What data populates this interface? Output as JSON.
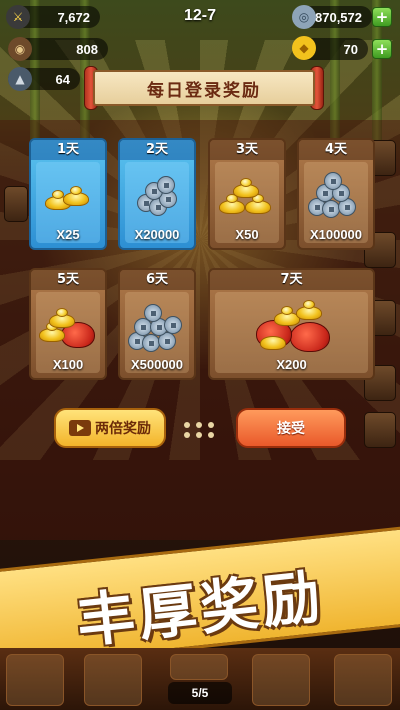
{
  "hud": {
    "exp_value": "7,672",
    "level": "12-7",
    "silver_value": "870,572",
    "coin_value": "808",
    "gold_value": "70",
    "partial_value": "64",
    "plus_label": "+"
  },
  "dialog": {
    "title": "每日登录奖励",
    "rewards": [
      {
        "day_label": "1天",
        "amount": "X25",
        "item": "gold-ingots-icon"
      },
      {
        "day_label": "2天",
        "amount": "X20000",
        "item": "copper-coins-icon"
      },
      {
        "day_label": "3天",
        "amount": "X50",
        "item": "gold-ingots-icon"
      },
      {
        "day_label": "4天",
        "amount": "X100000",
        "item": "copper-coins-icon"
      },
      {
        "day_label": "5天",
        "amount": "X100",
        "item": "gold-bag-icon"
      },
      {
        "day_label": "6天",
        "amount": "X500000",
        "item": "copper-coins-icon"
      },
      {
        "day_label": "7天",
        "amount": "X200",
        "item": "gold-bag-icon"
      }
    ],
    "double_button": "两倍奖励",
    "accept_button": "接受"
  },
  "slogan": "丰厚奖励",
  "bottom": {
    "page_indicator": "5/5"
  },
  "colors": {
    "claimed_card": "#2d8fd3",
    "pending_card": "#7c4f2c",
    "accept": "#e9592a",
    "double": "#f3b42a"
  }
}
